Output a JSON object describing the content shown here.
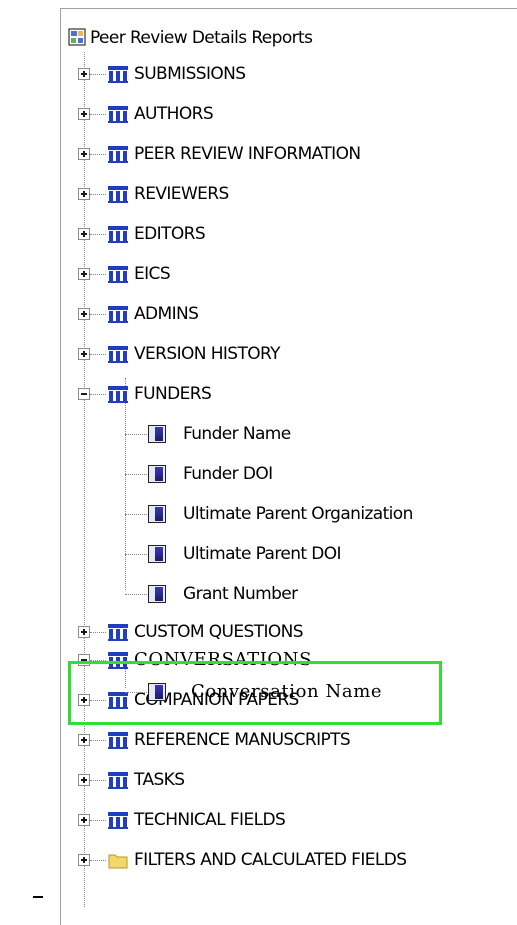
{
  "tree": {
    "root": {
      "label": "Peer Review Details Reports",
      "icon": "report-icon"
    },
    "folders": [
      {
        "label": "SUBMISSIONS",
        "expanded": false
      },
      {
        "label": "AUTHORS",
        "expanded": false
      },
      {
        "label": "PEER REVIEW INFORMATION",
        "expanded": false
      },
      {
        "label": "REVIEWERS",
        "expanded": false
      },
      {
        "label": "EDITORS",
        "expanded": false
      },
      {
        "label": "EICS",
        "expanded": false
      },
      {
        "label": "ADMINS",
        "expanded": false
      },
      {
        "label": "VERSION HISTORY",
        "expanded": false
      },
      {
        "label": "FUNDERS",
        "expanded": true
      },
      {
        "label": "CUSTOM QUESTIONS",
        "expanded": false
      },
      {
        "label": "CONVERSATIONS",
        "expanded": true
      },
      {
        "label": "COMPANION PAPERS",
        "expanded": false
      },
      {
        "label": "REFERENCE MANUSCRIPTS",
        "expanded": false
      },
      {
        "label": "TASKS",
        "expanded": false
      },
      {
        "label": "TECHNICAL FIELDS",
        "expanded": false
      },
      {
        "label": "FILTERS AND CALCULATED FIELDS",
        "expanded": false
      }
    ],
    "funder_fields": [
      "Funder Name",
      "Funder DOI",
      "Ultimate Parent Organization",
      "Ultimate Parent DOI",
      "Grant Number"
    ],
    "conversation_fields": [
      "Conversation Name"
    ]
  },
  "highlight_color": "#33dd33",
  "icon_color": "#1f3fbf"
}
